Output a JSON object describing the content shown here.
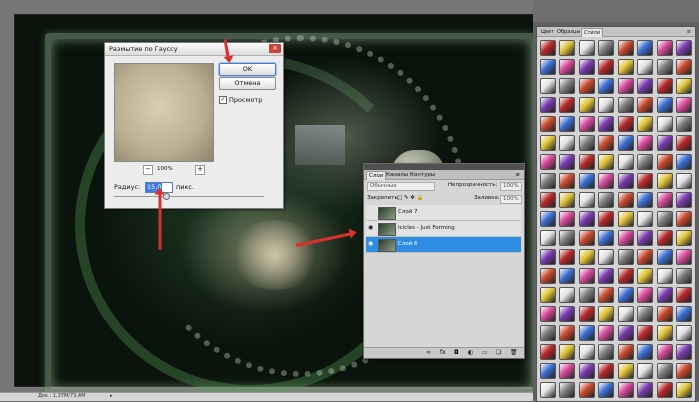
{
  "app": {
    "status_info": "Док.: 1,37M/73,4M"
  },
  "gauss_dialog": {
    "title": "Размытие по Гауссу",
    "ok_label": "OK",
    "cancel_label": "Отмена",
    "preview_label": "Просмотр",
    "preview_checked": true,
    "zoom_value": "100%",
    "zoom_minus": "−",
    "zoom_plus": "+",
    "radius_label": "Радиус:",
    "radius_value": "15,0",
    "radius_unit": "пикс."
  },
  "layers_panel": {
    "tabs": [
      "Слои",
      "Каналы",
      "Контуры"
    ],
    "blend_mode": "Обычные",
    "opacity_label": "Непрозрачность:",
    "opacity_value": "100%",
    "lock_label": "Закрепить:",
    "fill_label": "Заливка:",
    "fill_value": "100%",
    "layers": [
      {
        "name": "Слой 7",
        "visible": false,
        "selected": false
      },
      {
        "name": "Icicles - Just Forming",
        "visible": true,
        "selected": false
      },
      {
        "name": "Слой 6",
        "visible": true,
        "selected": true
      }
    ],
    "bottom_icons": [
      "link-icon",
      "fx-icon",
      "mask-icon",
      "adjustment-icon",
      "folder-icon",
      "new-layer-icon",
      "trash-icon"
    ]
  },
  "styles_panel": {
    "tabs": [
      "Цвет",
      "Образцы",
      "Стили"
    ],
    "active_tab": "Стили",
    "swatch_colors": [
      "#b8282a",
      "#3b6fd4",
      "#e3e3e3",
      "#7a3bb0",
      "#c94a2e",
      "#e0c43a",
      "#d84a9c",
      "#7f7f7f"
    ]
  }
}
